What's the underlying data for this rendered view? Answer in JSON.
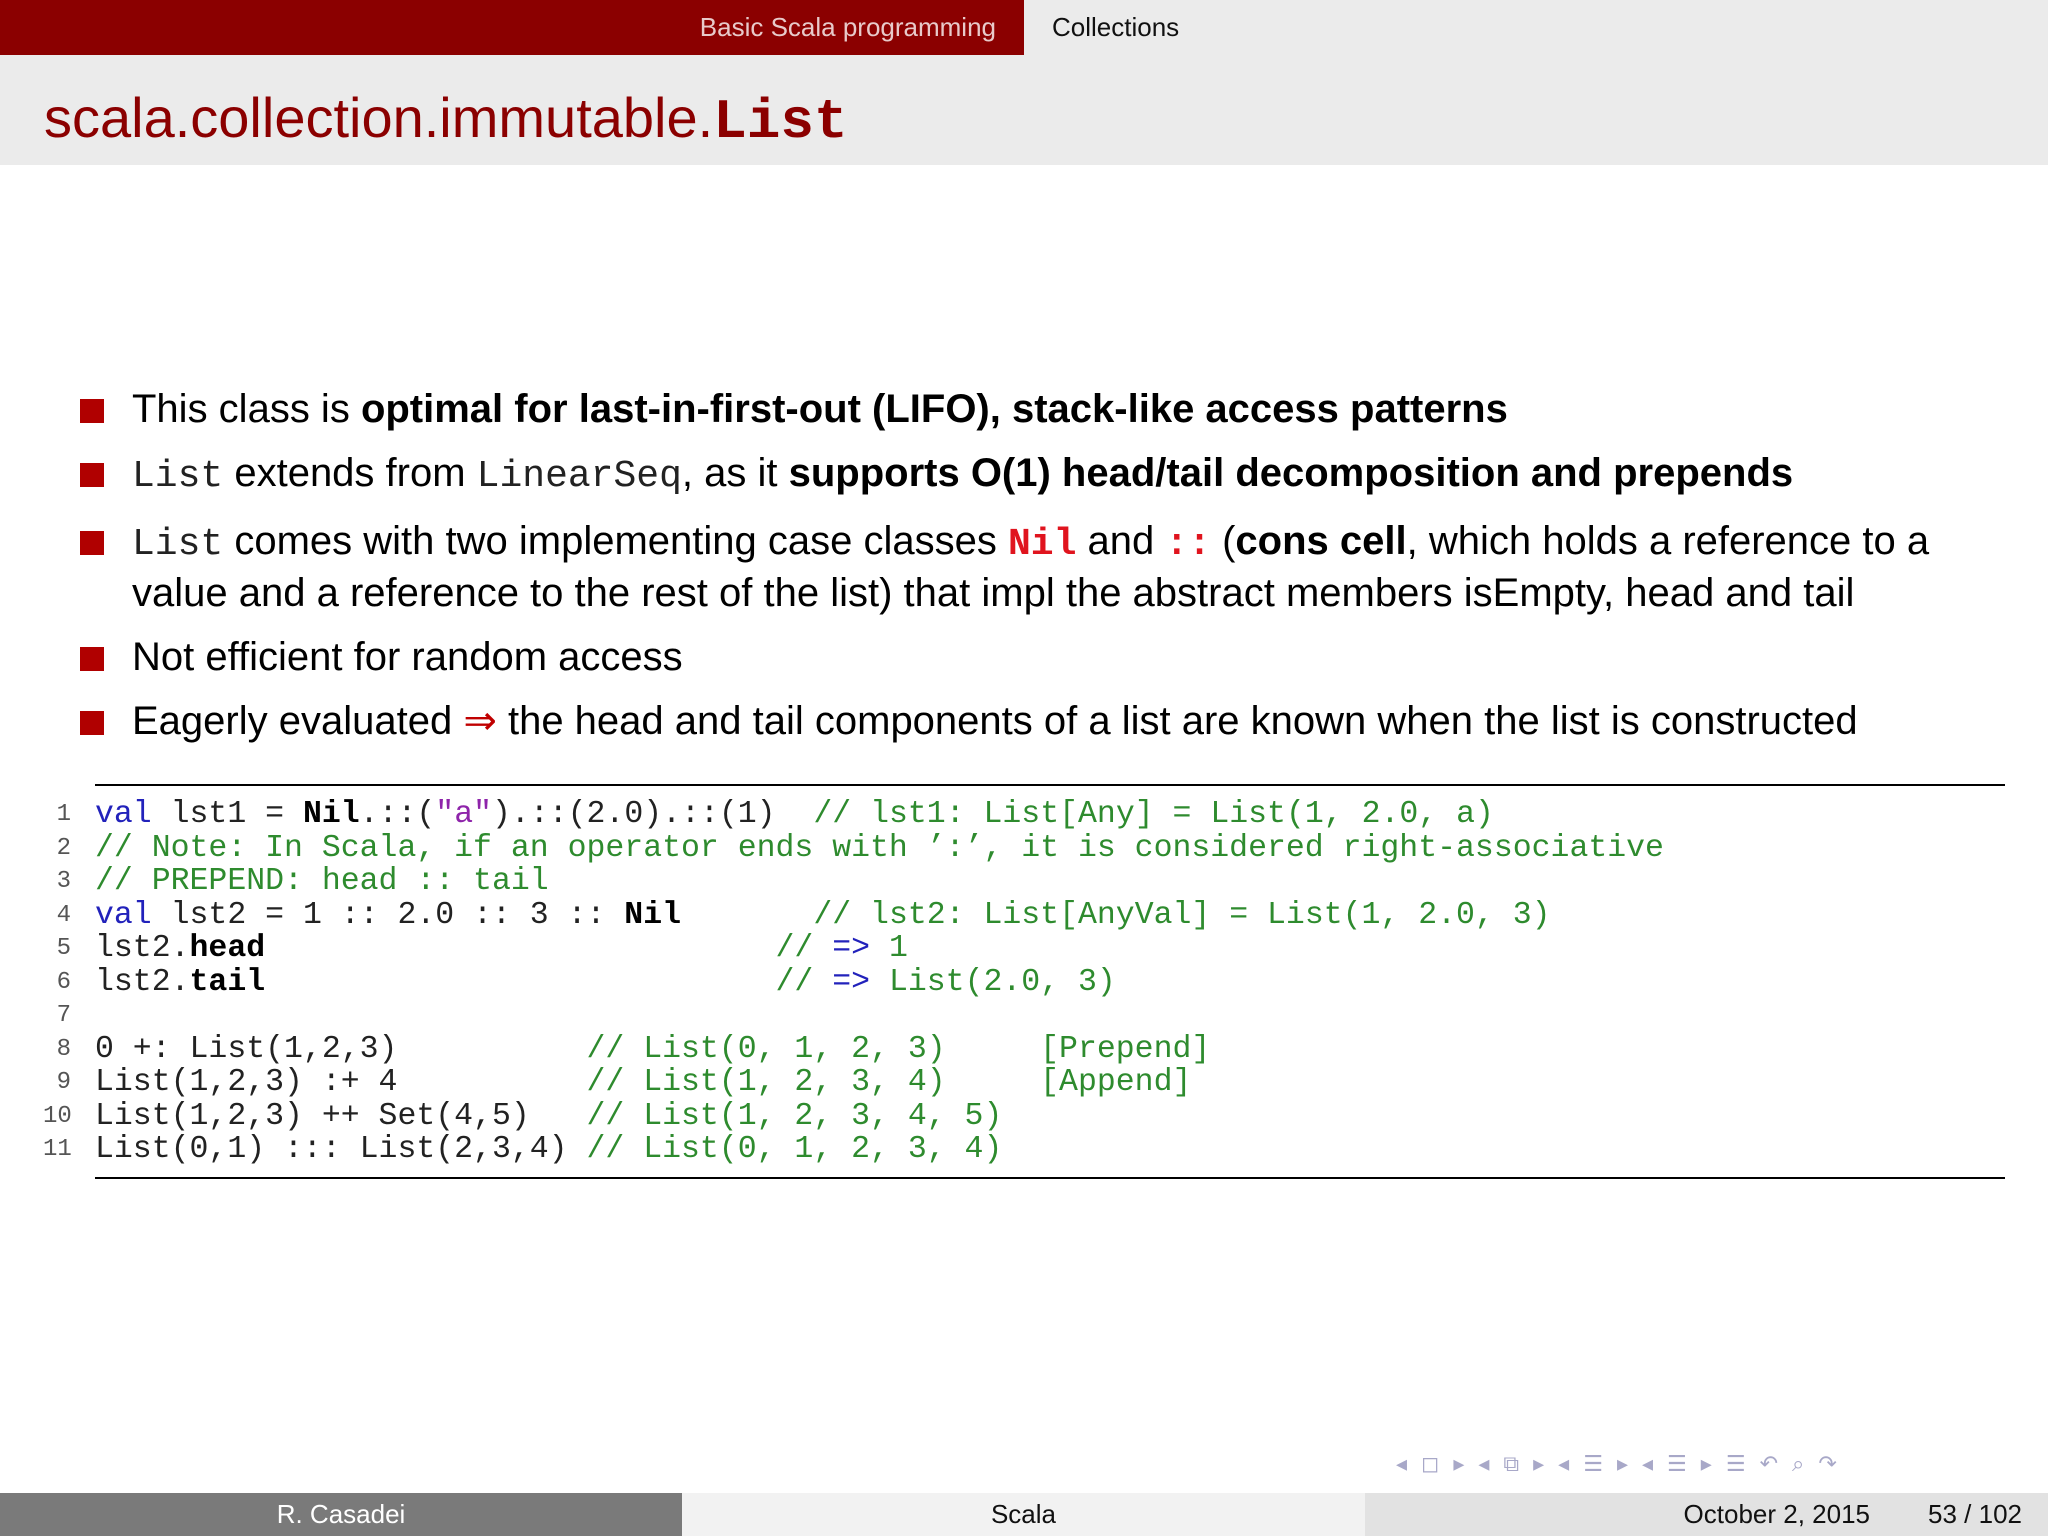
{
  "nav": {
    "section_left": "Basic Scala programming",
    "section_right": "Collections"
  },
  "title": {
    "prefix": "scala.collection.immutable.",
    "mono": "List"
  },
  "bullets": {
    "b1": {
      "t1": "This class is ",
      "bold": "optimal for last-in-first-out (LIFO), stack-like access patterns"
    },
    "b2": {
      "m1": "List",
      "t1": " extends from ",
      "m2": "LinearSeq",
      "t2": ", as it ",
      "bold": "supports O(1) head/tail decomposition and prepends"
    },
    "b3": {
      "m1": "List",
      "t1": " comes with two implementing case classes ",
      "r1": "Nil",
      "t2": " and ",
      "r2": "::",
      "t3": " (",
      "bold": "cons cell",
      "t4": ", which holds a reference to a value and a reference to the rest of the list) that impl the abstract members isEmpty, head and tail"
    },
    "b4": {
      "t1": "Not efficient for random access"
    },
    "b5": {
      "t1": "Eagerly evaluated ",
      "arrow": "⇒",
      "t2": " the head and tail components of a list are known when the list is constructed"
    }
  },
  "code": {
    "line_numbers": [
      "1",
      "2",
      "3",
      "4",
      "5",
      "6",
      "7",
      "8",
      "9",
      "10",
      "11"
    ],
    "l1": {
      "kw": "val",
      "a": " lst1 = ",
      "b": "Nil",
      "c": ".::(",
      "s": "\"a\"",
      "d": ").::(2.0).::(1)  ",
      "cm": "// lst1: List[Any] = List(1, 2.0, a)"
    },
    "l2": {
      "cm": "// Note: In Scala, if an operator ends with ’:’, it is considered right-associative"
    },
    "l3": {
      "cm": "// PREPEND: head :: tail"
    },
    "l4": {
      "kw": "val",
      "a": " lst2 = 1 :: 2.0 :: 3 :: ",
      "b": "Nil",
      "pad": "       ",
      "cm": "// lst2: List[AnyVal] = List(1, 2.0, 3)"
    },
    "l5": {
      "a": "lst2.",
      "b": "head",
      "pad": "                           ",
      "cm1": "// ",
      "arr": "=>",
      "cm2": " 1"
    },
    "l6": {
      "a": "lst2.",
      "b": "tail",
      "pad": "                           ",
      "cm1": "// ",
      "arr": "=>",
      "cm2": " List(2.0, 3)"
    },
    "l8": {
      "a": "0 +: List(1,2,3)          ",
      "cm": "// List(0, 1, 2, 3)     [Prepend]"
    },
    "l9": {
      "a": "List(1,2,3) :+ 4          ",
      "cm": "// List(1, 2, 3, 4)     [Append]"
    },
    "l10": {
      "a": "List(1,2,3) ++ Set(4,5)   ",
      "cm": "// List(1, 2, 3, 4, 5)"
    },
    "l11": {
      "a": "List(0,1) ::: List(2,3,4) ",
      "cm": "// List(0, 1, 2, 3, 4)"
    }
  },
  "footer": {
    "author": "R. Casadei",
    "title": "Scala",
    "date": "October 2, 2015",
    "page": "53 / 102"
  }
}
